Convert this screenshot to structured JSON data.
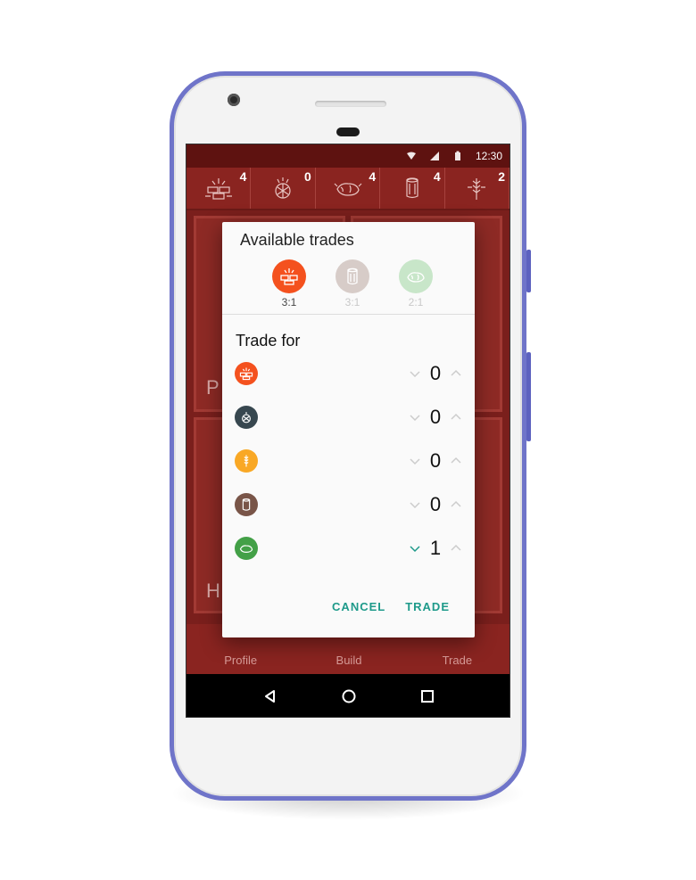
{
  "status_bar": {
    "time": "12:30"
  },
  "resources": [
    {
      "name": "brick-icon",
      "count": "4"
    },
    {
      "name": "ore-icon",
      "count": "0"
    },
    {
      "name": "sheep-icon",
      "count": "4"
    },
    {
      "name": "wood-icon",
      "count": "4"
    },
    {
      "name": "wheat-icon",
      "count": "2"
    }
  ],
  "background": {
    "card_letter_1": "P",
    "card_letter_2": "H"
  },
  "bottom_nav": {
    "profile": "Profile",
    "build": "Build",
    "trade": "Trade"
  },
  "dialog": {
    "title": "Available trades",
    "trades": [
      {
        "icon": "brick-icon",
        "ratio": "3:1",
        "color": "#f4511e",
        "active": true
      },
      {
        "icon": "wood-icon",
        "ratio": "3:1",
        "color": "#d7ccc8",
        "active": false
      },
      {
        "icon": "sheep-icon",
        "ratio": "2:1",
        "color": "#c8e6c9",
        "active": false
      }
    ],
    "trade_for_label": "Trade for",
    "rows": [
      {
        "icon": "brick-icon",
        "color": "#f4511e",
        "value": "0"
      },
      {
        "icon": "ore-icon",
        "color": "#37474f",
        "value": "0"
      },
      {
        "icon": "wheat-icon",
        "color": "#f9a825",
        "value": "0"
      },
      {
        "icon": "wood-icon",
        "color": "#795548",
        "value": "0"
      },
      {
        "icon": "sheep-icon",
        "color": "#43a047",
        "value": "1"
      }
    ],
    "cancel_label": "CANCEL",
    "trade_label": "TRADE"
  },
  "colors": {
    "accent": "#1e9a8a",
    "bar": "#8a2420",
    "frame": "#6f74c9"
  }
}
